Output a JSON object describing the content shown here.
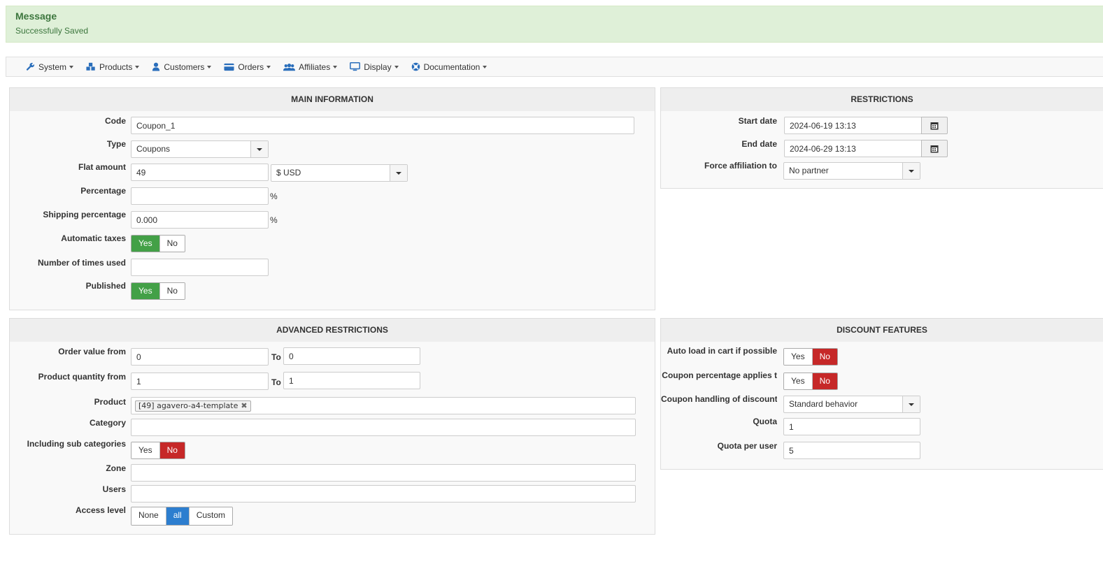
{
  "message": {
    "title": "Message",
    "text": "Successfully Saved"
  },
  "menu": [
    {
      "label": "System",
      "icon": "wrench-icon"
    },
    {
      "label": "Products",
      "icon": "cubes-icon"
    },
    {
      "label": "Customers",
      "icon": "user-icon"
    },
    {
      "label": "Orders",
      "icon": "credit-card-icon"
    },
    {
      "label": "Affiliates",
      "icon": "users-icon"
    },
    {
      "label": "Display",
      "icon": "monitor-icon"
    },
    {
      "label": "Documentation",
      "icon": "lifebuoy-icon"
    }
  ],
  "main": {
    "title": "MAIN INFORMATION",
    "code_label": "Code",
    "code_value": "Coupon_1",
    "type_label": "Type",
    "type_value": "Coupons",
    "flat_label": "Flat amount",
    "flat_value": "49",
    "currency_value": "$ USD",
    "percentage_label": "Percentage",
    "percentage_value": "",
    "percent_sign": "%",
    "shipping_label": "Shipping percentage",
    "shipping_value": "0.000",
    "auto_taxes_label": "Automatic taxes",
    "times_used_label": "Number of times used",
    "times_used_value": "",
    "published_label": "Published",
    "yes": "Yes",
    "no": "No"
  },
  "restrictions": {
    "title": "RESTRICTIONS",
    "start_label": "Start date",
    "start_value": "2024-06-19 13:13",
    "end_label": "End date",
    "end_value": "2024-06-29 13:13",
    "affiliation_label": "Force affiliation to",
    "affiliation_value": "No partner"
  },
  "advanced": {
    "title": "ADVANCED RESTRICTIONS",
    "order_from_label": "Order value from",
    "order_from_value": "0",
    "to_label": "To",
    "order_to_value": "0",
    "qty_from_label": "Product quantity from",
    "qty_from_value": "1",
    "qty_to_value": "1",
    "product_label": "Product",
    "product_tag": "[49] agavero-a4-template",
    "category_label": "Category",
    "subcat_label": "Including sub categories",
    "zone_label": "Zone",
    "users_label": "Users",
    "access_label": "Access level",
    "access_none": "None",
    "access_all": "all",
    "access_custom": "Custom"
  },
  "discount": {
    "title": "DISCOUNT FEATURES",
    "autoload_label": "Auto load in cart if possible",
    "applies_label": "Coupon percentage applies t",
    "handling_label": "Coupon handling of discount",
    "handling_value": "Standard behavior",
    "quota_label": "Quota",
    "quota_value": "1",
    "quota_user_label": "Quota per user",
    "quota_user_value": "5"
  }
}
